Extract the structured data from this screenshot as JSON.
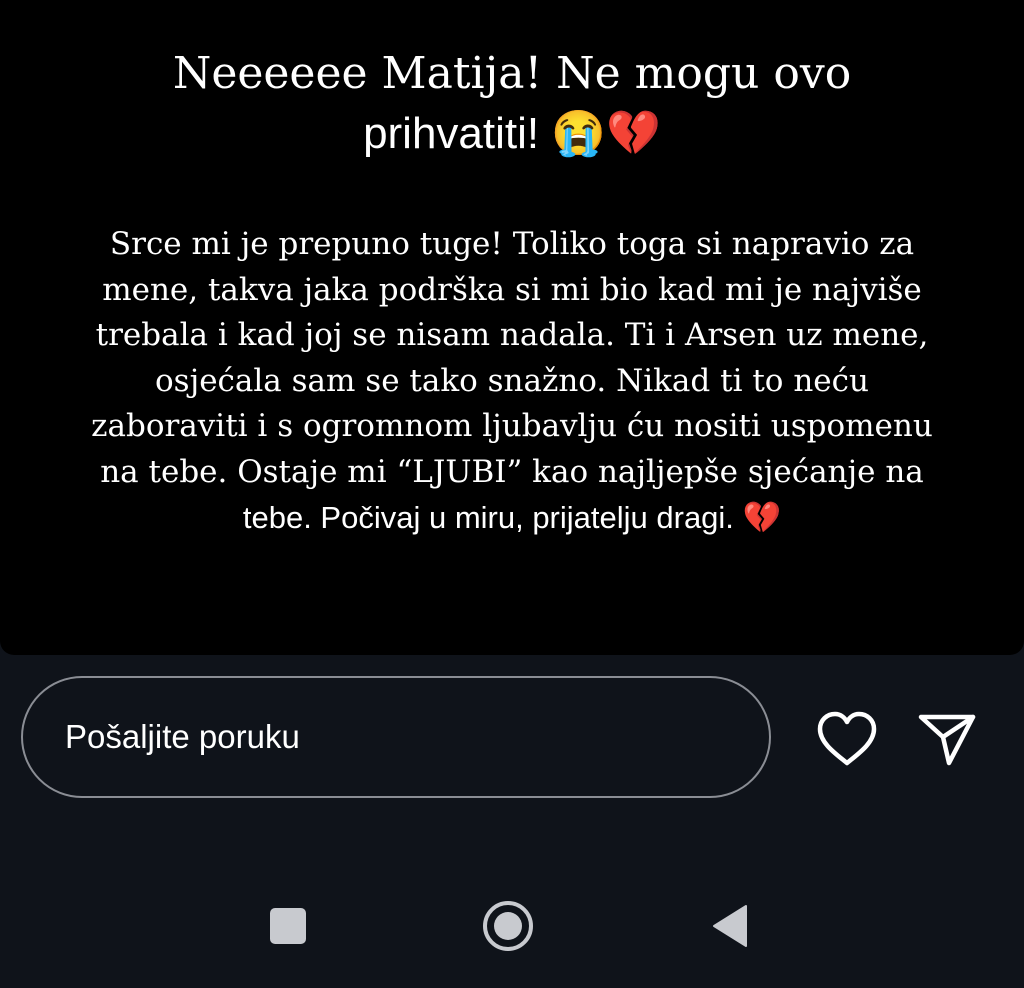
{
  "story": {
    "headline_line1": "Neeeeee Matija! Ne mogu ovo",
    "headline_line2": "prihvatiti! 😭💔",
    "body_lines": [
      "Srce mi je prepuno tuge! Toliko toga si napravio za",
      "mene, takva jaka podrška si mi bio kad mi je najviše",
      "trebala i kad joj se nisam nadala. Ti i Arsen uz mene,",
      "osjećala sam se tako snažno. Nikad ti to neću",
      "zaboraviti i s ogromnom ljubavlju ću nositi uspomenu",
      "na tebe. Ostaje mi “LJUBI” kao najljepše sjećanje na",
      "tebe. Počivaj u miru, prijatelju dragi. 💔"
    ]
  },
  "reply": {
    "placeholder": "Pošaljite poruku",
    "like_icon": "heart-outline-icon",
    "send_icon": "paper-plane-icon"
  },
  "nav": {
    "recents_icon": "square-icon",
    "home_icon": "circle-icon",
    "back_icon": "triangle-back-icon"
  },
  "colors": {
    "story_bg": "#000000",
    "screen_bg": "#0f131a",
    "input_border": "#8a8d94",
    "nav_icon": "#c8cacf"
  }
}
